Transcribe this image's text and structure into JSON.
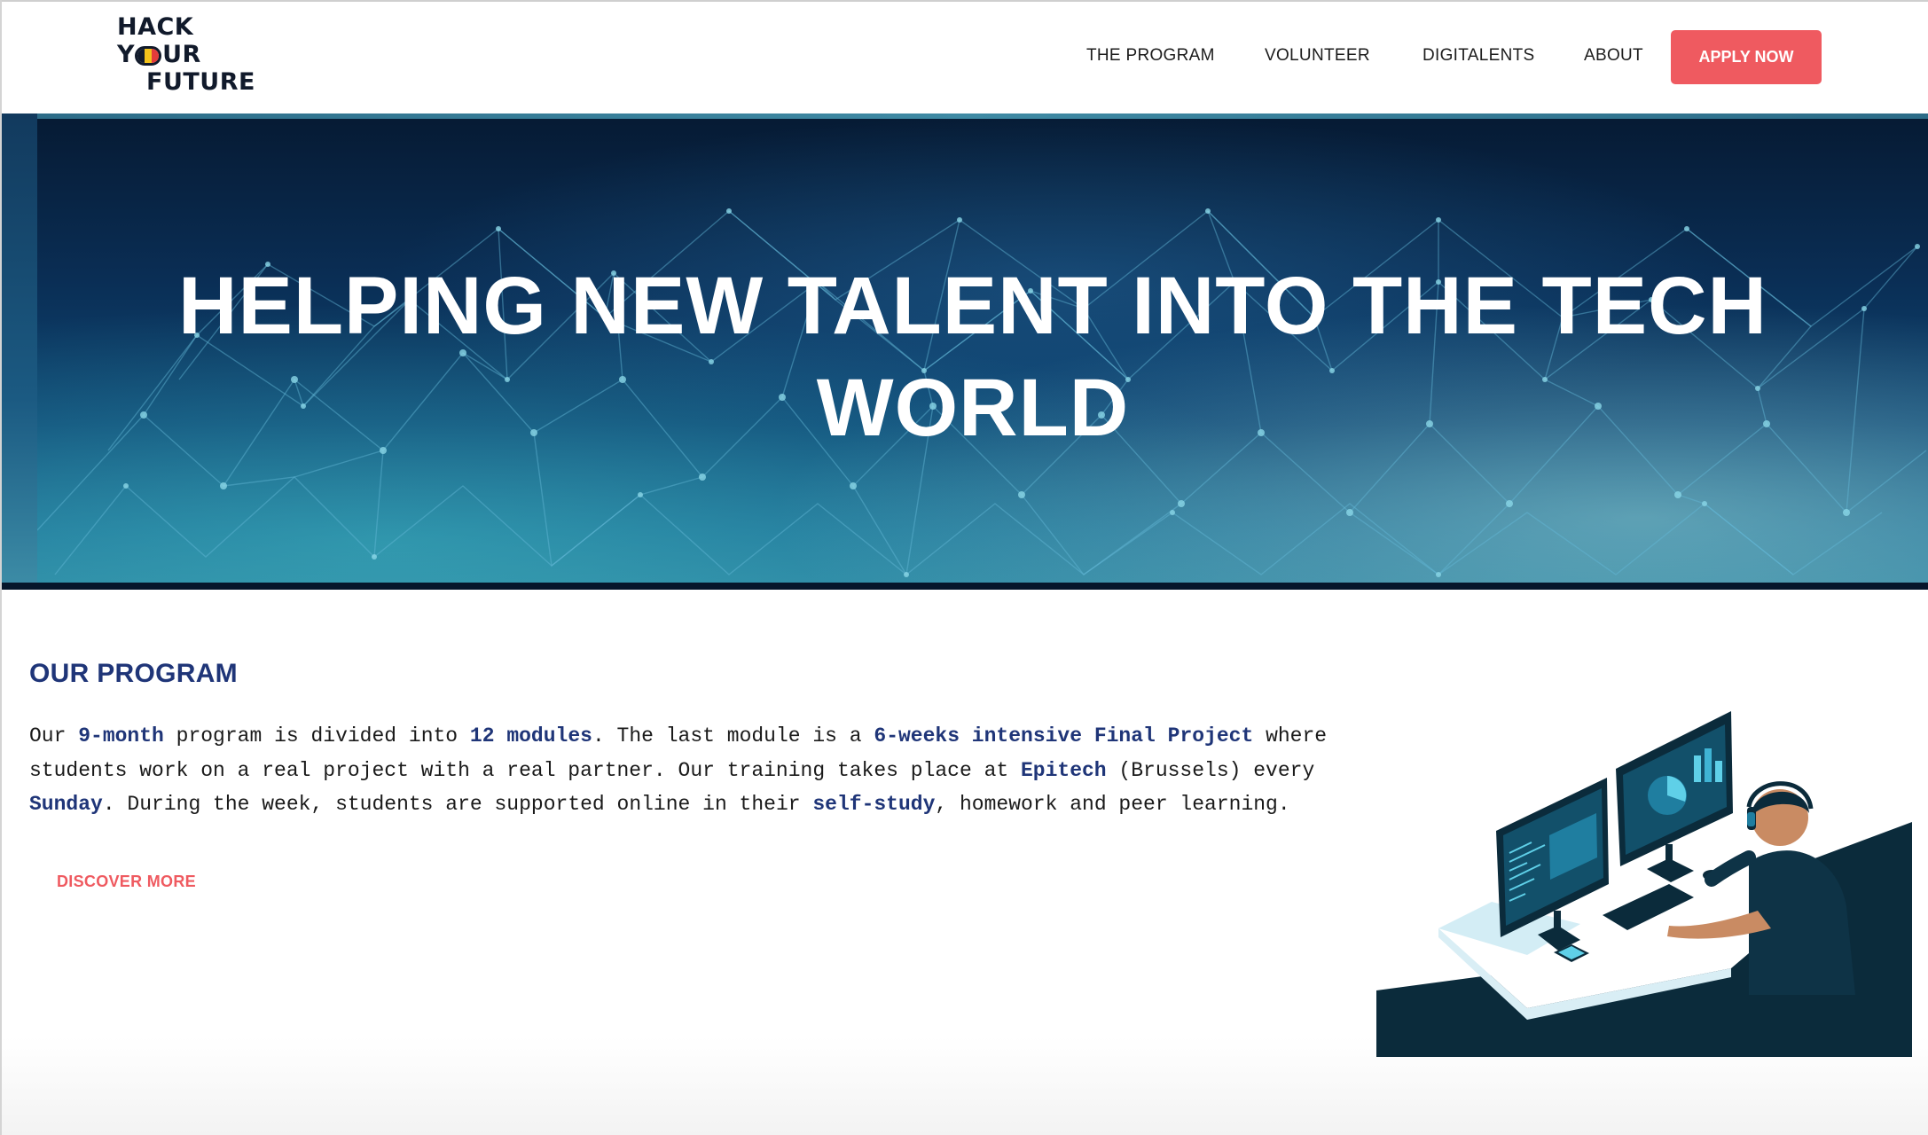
{
  "logo": {
    "line1": "HACK",
    "line2_left": "Y",
    "line2_right": "UR",
    "line3": "FUTURE"
  },
  "nav": {
    "items": [
      {
        "label": "THE PROGRAM"
      },
      {
        "label": "VOLUNTEER"
      },
      {
        "label": "DIGITALENTS"
      },
      {
        "label": "ABOUT"
      }
    ],
    "apply_label": "APPLY NOW"
  },
  "hero": {
    "title": "HELPING NEW TALENT INTO THE TECH WORLD"
  },
  "program": {
    "title": "OUR PROGRAM",
    "text": {
      "p1": "Our ",
      "h1": "9-month",
      "p2": " program is divided into ",
      "h2": "12 modules",
      "p3": ". The last module is a ",
      "h3": "6-weeks intensive Final Project",
      "p4": " where students work on a real project with a real partner. Our training takes place at ",
      "h4": "Epitech",
      "p5": " (Brussels) every ",
      "h5": "Sunday",
      "p6": ". During the week, students are supported online in their ",
      "h6": "self-study",
      "p7": ", homework and peer learning."
    },
    "discover_label": "DISCOVER MORE"
  },
  "colors": {
    "accent": "#ef5a60",
    "navy": "#1f3578",
    "hero_dark": "#061a33"
  }
}
